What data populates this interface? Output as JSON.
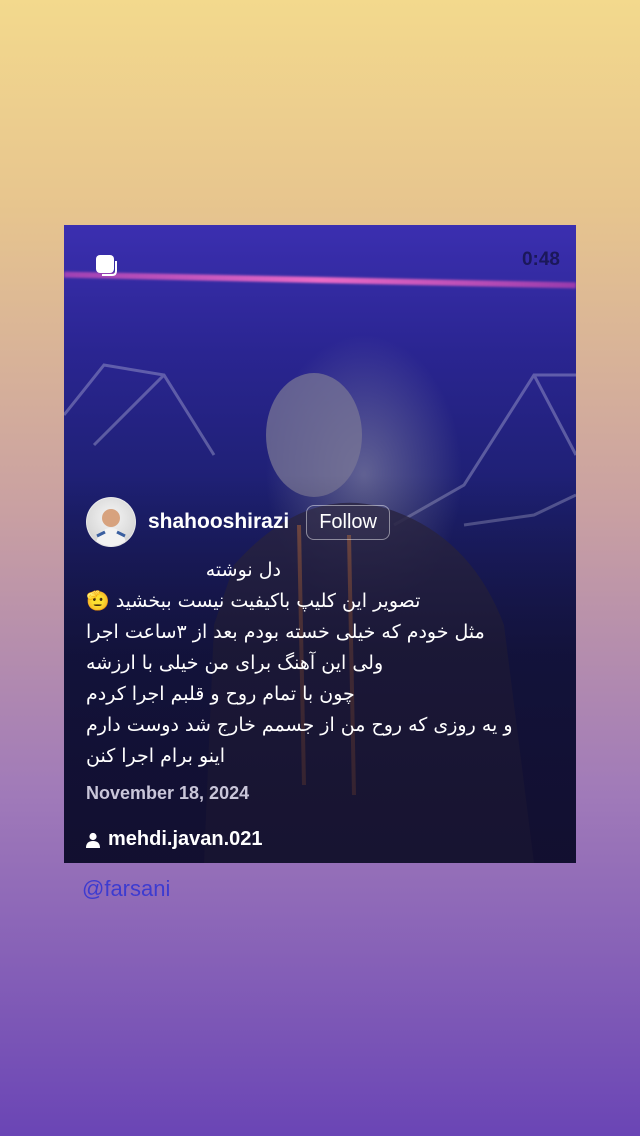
{
  "post": {
    "timer": "0:48",
    "username": "shahooshirazi",
    "follow_label": "Follow",
    "caption_lines": [
      "دل نوشته",
      "تصویر این کلیپ باکیفیت نیست ببخشید 🫡",
      "مثل خودم که خیلی خسته بودم بعد از ۳ساعت اجرا",
      "ولی این آهنگ برای من خیلی با ارزشه",
      "چون با تمام روح و قلبم اجرا کردم",
      "و یه روزی که روح من از جسمم خارج شد دوست دارم",
      "اینو برام اجرا کنن"
    ],
    "date": "November 18, 2024",
    "tagged_user": "mehdi.javan.021",
    "icons": [
      "reels-icon",
      "person-icon"
    ]
  },
  "story": {
    "mention": "@farsani",
    "colors": {
      "gradient_top": "#f3d98d",
      "gradient_bottom": "#6a45b5",
      "mention": "#3d3bd0"
    }
  }
}
